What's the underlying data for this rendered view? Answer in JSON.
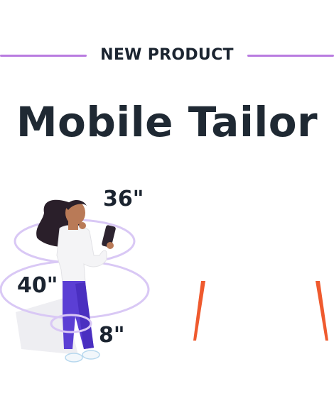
{
  "header": {
    "eyebrow": "NEW PRODUCT",
    "title": "Mobile Tailor"
  },
  "illustration": {
    "measurements": {
      "chest": "36\"",
      "waist": "40\"",
      "ankle": "8\""
    }
  },
  "colors": {
    "accent_line": "#b97be0",
    "title_text": "#1f2933",
    "ring": "#d9c8f5",
    "pants": "#5b3fd4",
    "shirt": "#f4f4f6",
    "skin": "#b97a57",
    "hair": "#2a1f2a",
    "orange_stroke": "#ef5a2e"
  }
}
